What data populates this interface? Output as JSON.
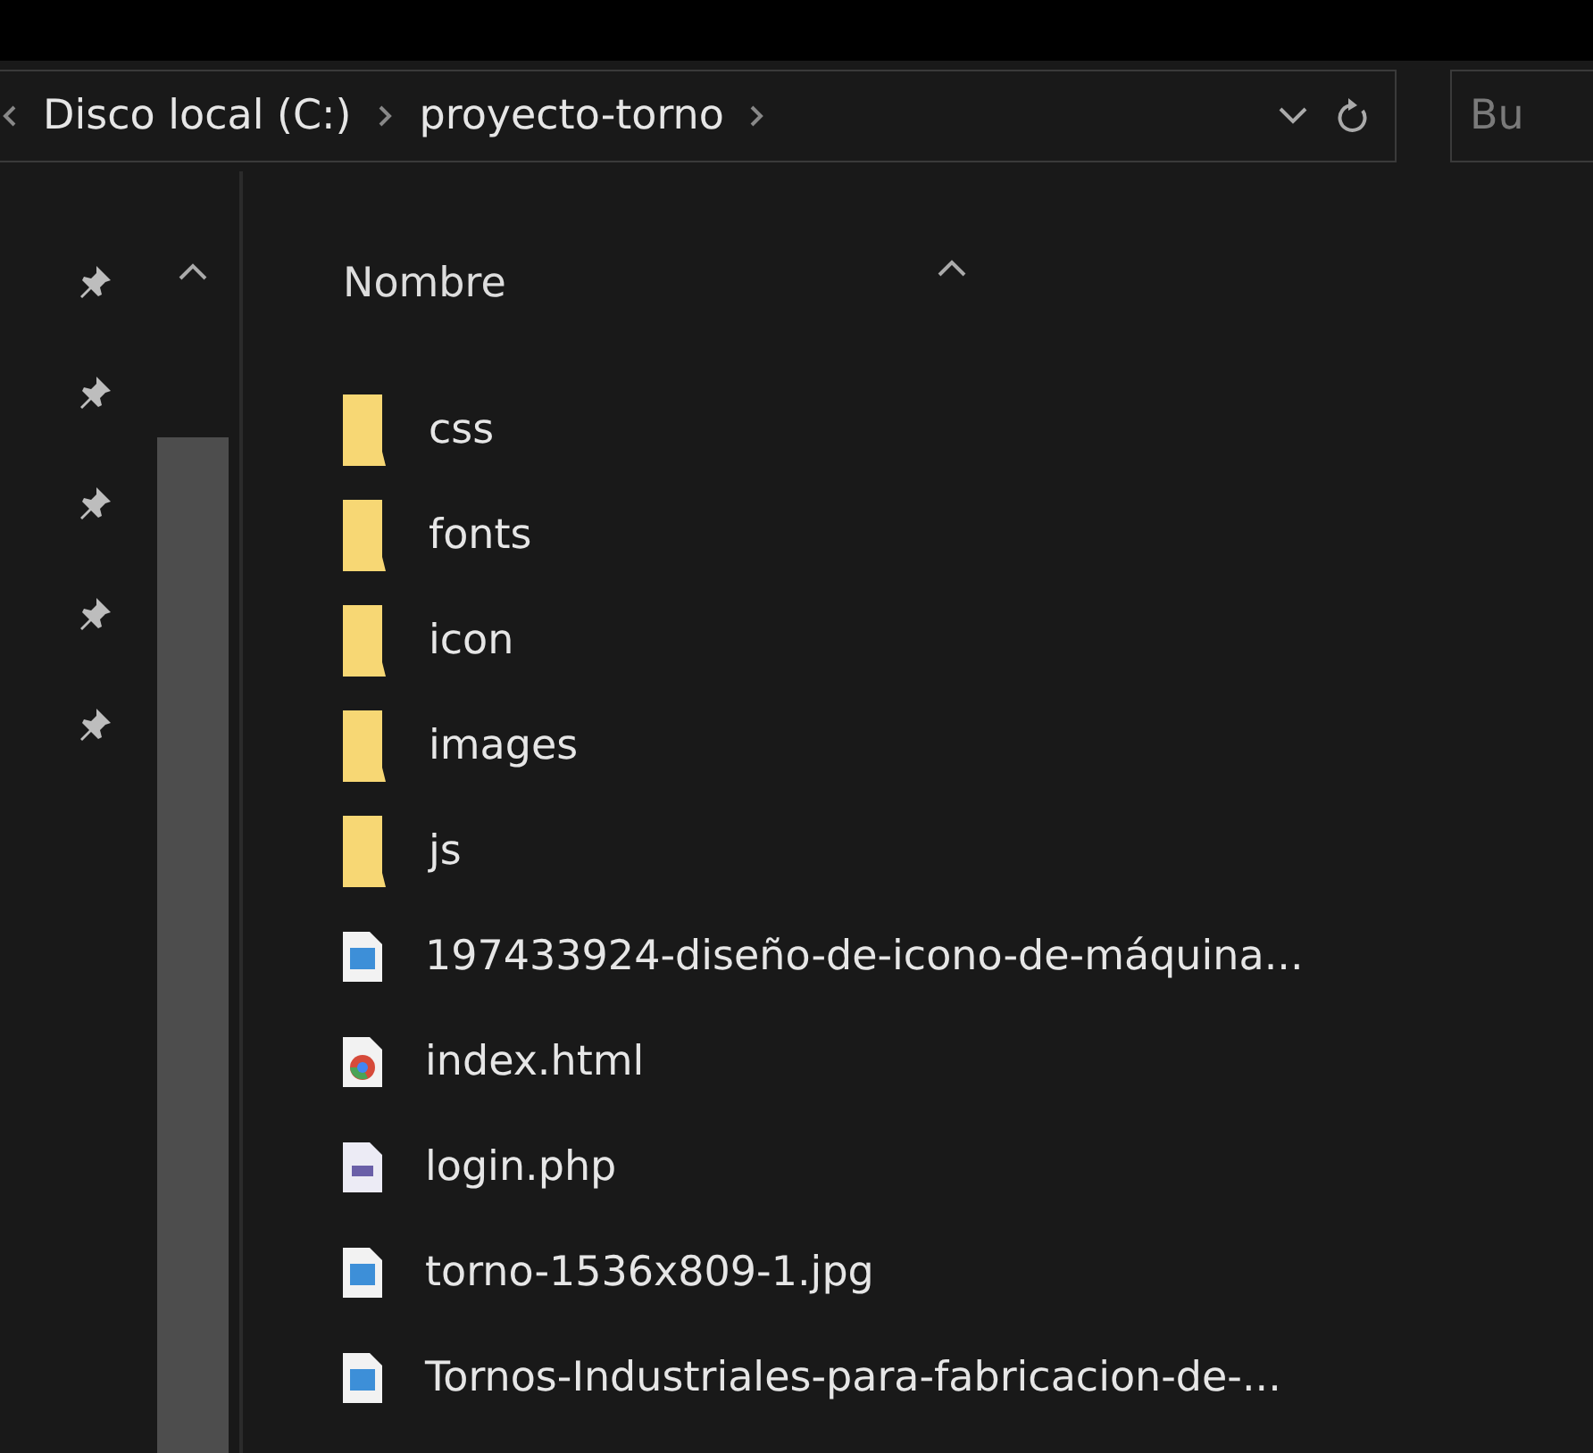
{
  "address_bar": {
    "crumbs": [
      "Disco local (C:)",
      "proyecto-torno"
    ]
  },
  "search": {
    "placeholder": "Bu"
  },
  "nav_pane": {
    "pins": [
      {
        "pinned": true
      },
      {
        "pinned": true
      },
      {
        "pinned": true
      },
      {
        "pinned": true
      },
      {
        "pinned": true
      }
    ]
  },
  "file_list": {
    "columns": [
      {
        "label": "Nombre",
        "sorted": true
      }
    ],
    "items": [
      {
        "name": "css",
        "kind": "folder"
      },
      {
        "name": "fonts",
        "kind": "folder"
      },
      {
        "name": "icon",
        "kind": "folder"
      },
      {
        "name": "images",
        "kind": "folder"
      },
      {
        "name": "js",
        "kind": "folder"
      },
      {
        "name": "197433924-diseño-de-icono-de-máquina...",
        "kind": "image"
      },
      {
        "name": "index.html",
        "kind": "html"
      },
      {
        "name": "login.php",
        "kind": "php"
      },
      {
        "name": "torno-1536x809-1.jpg",
        "kind": "image"
      },
      {
        "name": "Tornos-Industriales-para-fabricacion-de-...",
        "kind": "image"
      }
    ]
  }
}
